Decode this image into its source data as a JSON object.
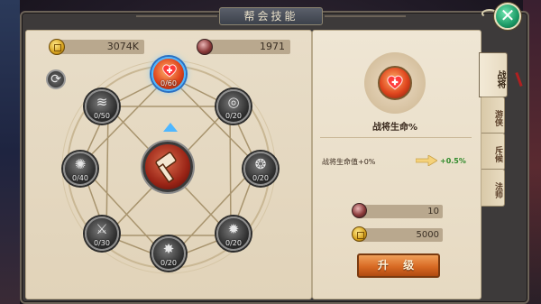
{
  "window": {
    "title": "帮会技能"
  },
  "resources": {
    "gold": "3074K",
    "orb": "1971"
  },
  "skill_wheel": {
    "nodes": [
      {
        "id": "top",
        "count": "0/60",
        "active": true
      },
      {
        "id": "upper-left",
        "count": "0/50"
      },
      {
        "id": "upper-right",
        "count": "0/20"
      },
      {
        "id": "left",
        "count": "0/40"
      },
      {
        "id": "right",
        "count": "0/20"
      },
      {
        "id": "lower-left",
        "count": "0/30"
      },
      {
        "id": "lower-right",
        "count": "0/20"
      },
      {
        "id": "bottom",
        "count": "0/20"
      }
    ]
  },
  "detail": {
    "skill_name": "战将生命%",
    "stat_label": "战将生命值+0%",
    "stat_gain": "+0.5%",
    "cost_orb": "10",
    "cost_gold": "5000",
    "upgrade_label": "升 级"
  },
  "tabs": [
    {
      "label": "战将",
      "active": true
    },
    {
      "label": "游侠"
    },
    {
      "label": "斥候"
    },
    {
      "label": "法师"
    }
  ],
  "close_label": "✕",
  "colors": {
    "accent_blue": "#4fb6ff",
    "upgrade_orange": "#d86a24",
    "gain_green": "#2f8a2a",
    "close_green": "#1c9a66"
  }
}
